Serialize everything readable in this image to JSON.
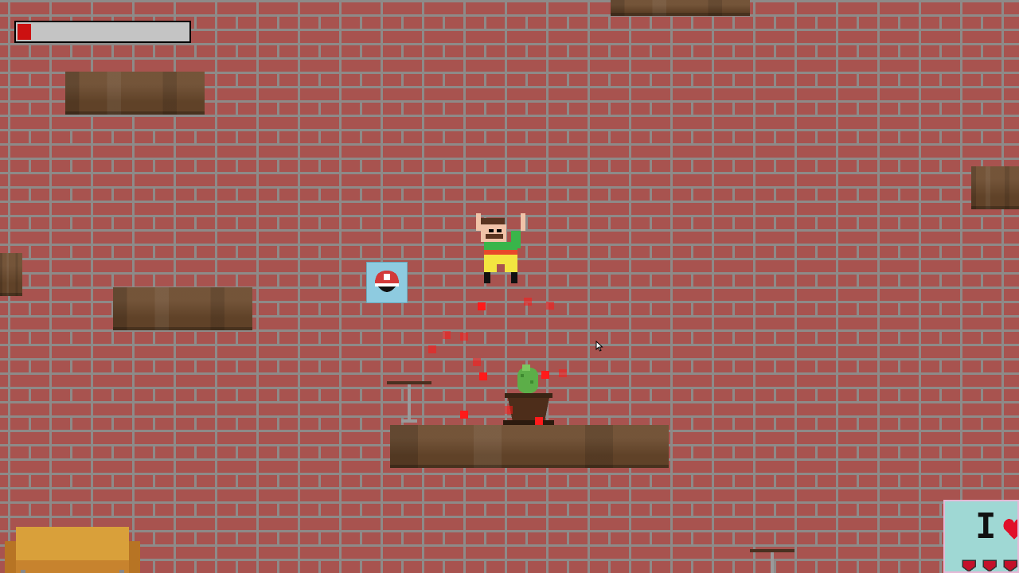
{
  "hud": {
    "health_fraction": 0.08,
    "health_color": "#cc1111"
  },
  "poster": {
    "text": "I"
  },
  "colors": {
    "brick": "#a8534f",
    "mortar": "#8e8a88",
    "shelf": "#6b4a2d",
    "powerup_bg": "#8ecbe0",
    "particle": "#ff1a1a"
  },
  "icons": {
    "player": "pixel-character-arms-raised",
    "powerup": "mushroom-icon",
    "plant": "potted-cactus",
    "poster_heart": "heart-icon"
  }
}
